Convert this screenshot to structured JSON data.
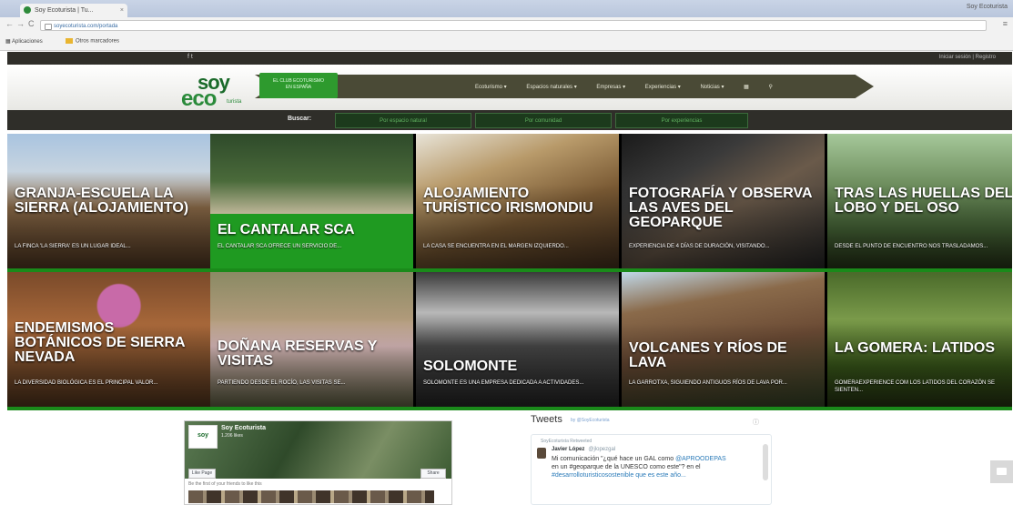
{
  "browser": {
    "tab_title": "Soy Ecoturista | Tu...",
    "tab_close": "×",
    "window_user": "Soy Ecoturista",
    "back": "←",
    "forward": "→",
    "reload": "C",
    "url": "soyecoturista.com/portada",
    "menu": "≡",
    "bookmarks": [
      "Aplicaciones",
      "Otros marcadores"
    ]
  },
  "site": {
    "topbar_share": "f  t",
    "topbar_login": "Iniciar sesión  |  Registro",
    "logo_soy": "soy",
    "logo_eco": "eco",
    "logo_turista": "turista",
    "badge_line1": "EL CLUB ECOTURISMO",
    "badge_line2": "EN ESPAÑA",
    "nav": [
      "Ecoturismo ▾",
      "Espacios naturales ▾",
      "Empresas ▾",
      "Experiencias ▾",
      "Noticias ▾",
      "▦",
      "⚲"
    ],
    "search_label": "Buscar:",
    "search_buttons": [
      "Por espacio natural",
      "Por comunidad",
      "Por experiencias"
    ]
  },
  "cards": [
    {
      "title": "GRANJA-ESCUELA LA SIERRA (ALOJAMIENTO)",
      "desc": "LA FINCA 'LA SIERRA' ES UN LUGAR IDEAL..."
    },
    {
      "title": "EL CANTALAR SCA",
      "desc": "EL CANTALAR SCA OFRECE UN SERVICIO DE..."
    },
    {
      "title": "ALOJAMIENTO TURÍSTICO IRISMONDIU",
      "desc": "LA CASA SE ENCUENTRA EN EL MARGEN IZQUIERDO..."
    },
    {
      "title": "FOTOGRAFÍA Y OBSERVA LAS AVES DEL GEOPARQUE",
      "desc": "EXPERIENCIA DE 4 DÍAS DE DURACIÓN, VISITANDO..."
    },
    {
      "title": "TRAS LAS HUELLAS DEL LOBO Y DEL OSO",
      "desc": "DESDE EL PUNTO DE ENCUENTRO NOS TRASLADAMOS..."
    },
    {
      "title": "ENDEMISMOS BOTÁNICOS DE SIERRA NEVADA",
      "desc": "LA DIVERSIDAD BIOLÓGICA ES EL PRINCIPAL VALOR..."
    },
    {
      "title": "DOÑANA RESERVAS Y VISITAS",
      "desc": "PARTIENDO DESDE EL ROCÍO, LAS VISITAS SE..."
    },
    {
      "title": "SOLOMONTE",
      "desc": "SOLOMONTE ES UNA EMPRESA DEDICADA A ACTIVIDADES..."
    },
    {
      "title": "VOLCANES Y RÍOS DE LAVA",
      "desc": "LA GARROTXA, SIGUIENDO ANTIGUOS RÍOS DE LAVA POR..."
    },
    {
      "title": "LA GOMERA: LATIDOS",
      "desc": "GOMERAEXPERIENCE COM LOS LATIDOS DEL CORAZÓN SE SIENTEN..."
    }
  ],
  "facebook": {
    "page_name": "Soy Ecoturista",
    "likes": "1.206 likes",
    "thumb_text": "soy",
    "like_btn": "Like Page",
    "share_btn": "Share",
    "friends": "Be the first of your friends to like this"
  },
  "tweets": {
    "title": "Tweets",
    "by": "by @SoyEcoturista",
    "info": "ⓘ",
    "retweeted": "SoyEcoturista Retweeted",
    "author": "Javier López",
    "handle": "@jlopezgal",
    "text_a": "Mi comunicación \"¿qué hace un GAL como ",
    "mention": "@APROODEPAS",
    "text_b": " en un #geoparque de la UNESCO como este\"? en el",
    "text_c": " #desarrolloturisticosostenible que es este año..."
  }
}
